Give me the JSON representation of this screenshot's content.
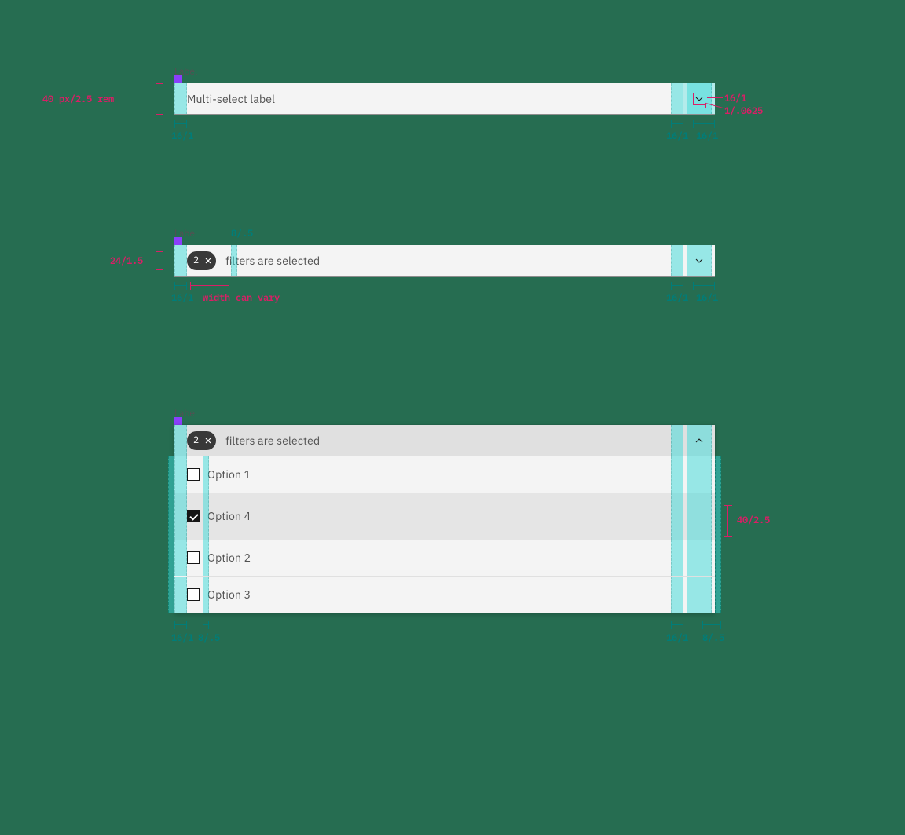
{
  "labels": {
    "label": "Label"
  },
  "example1": {
    "placeholder": "Multi-select label",
    "anno_height": "40 px/2.5 rem",
    "anno_icon_size": "16/1",
    "anno_stroke": "1/.0625",
    "ruler_left": "16/1",
    "ruler_pad_right": "16/1",
    "ruler_icon_col": "16/1"
  },
  "example2": {
    "count": "2",
    "text": "filters are selected",
    "anno_tag_h": "24/1.5",
    "anno_gap": "8/.5",
    "anno_width": "width can vary",
    "ruler_left": "16/1",
    "ruler_pad_right": "16/1",
    "ruler_icon_col": "16/1"
  },
  "example3": {
    "count": "2",
    "text": "filters are selected",
    "options": [
      {
        "label": "Option 1",
        "checked": false,
        "hover": false
      },
      {
        "label": "Option 4",
        "checked": true,
        "hover": true
      },
      {
        "label": "Option 2",
        "checked": false,
        "hover": false
      },
      {
        "label": "Option 3",
        "checked": false,
        "hover": false
      }
    ],
    "anno_row_h": "40/2.5",
    "ruler_left": "16/1",
    "ruler_cb_gap": "8/.5",
    "ruler_pad_right": "16/1",
    "ruler_out_right": "8/.5"
  }
}
